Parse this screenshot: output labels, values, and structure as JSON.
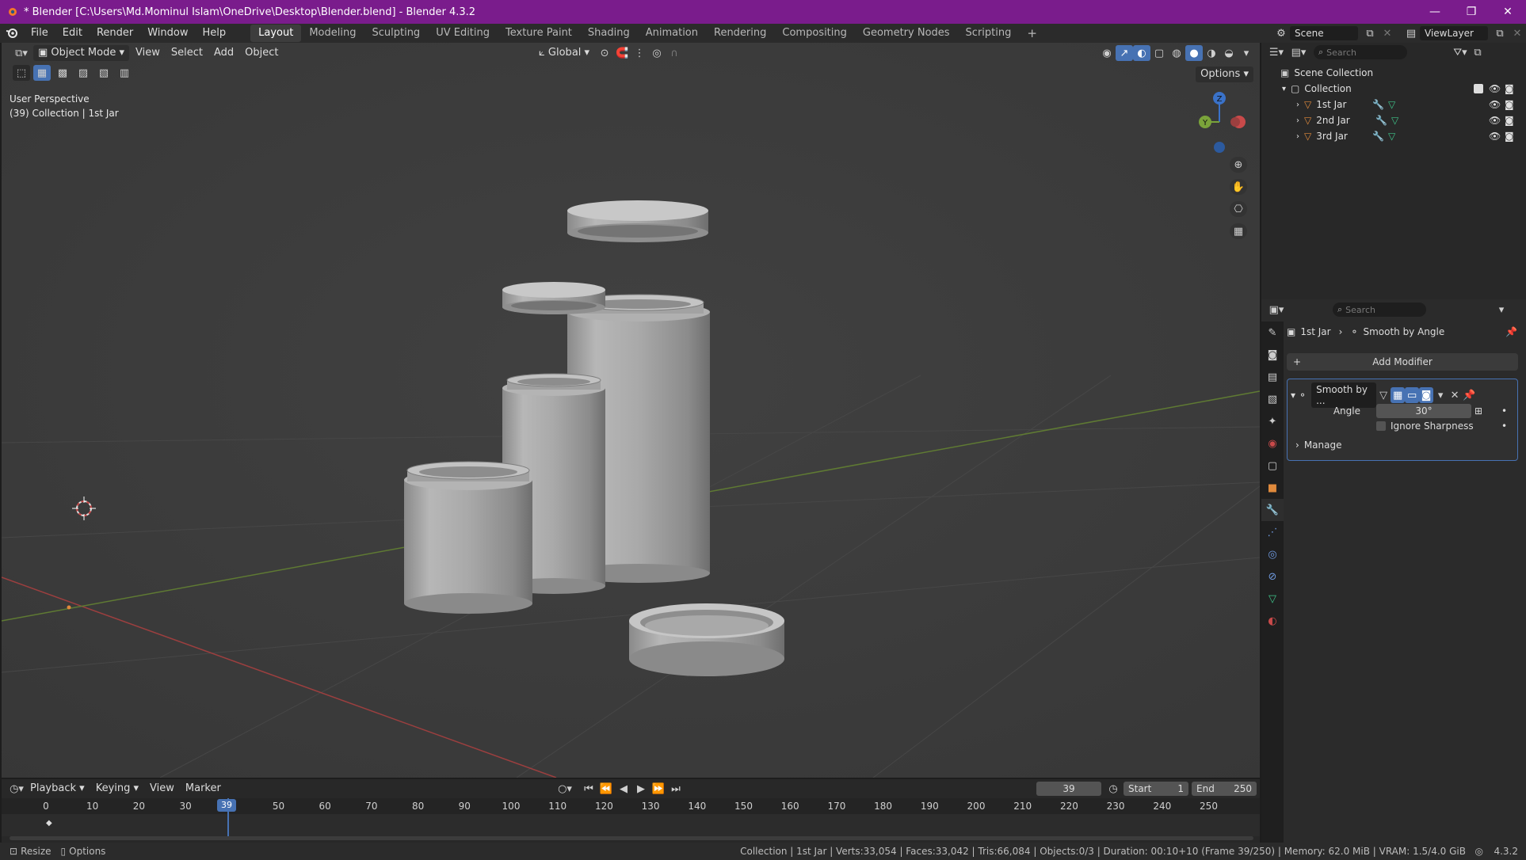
{
  "window": {
    "title": "* Blender [C:\\Users\\Md.Mominul Islam\\OneDrive\\Desktop\\Blender.blend] - Blender 4.3.2",
    "minimize": "—",
    "maximize": "❐",
    "close": "✕"
  },
  "menu": {
    "items": [
      "File",
      "Edit",
      "Render",
      "Window",
      "Help"
    ]
  },
  "workspaces": [
    "Layout",
    "Modeling",
    "Sculpting",
    "UV Editing",
    "Texture Paint",
    "Shading",
    "Animation",
    "Rendering",
    "Compositing",
    "Geometry Nodes",
    "Scripting"
  ],
  "workspace_add": "+",
  "scene": {
    "scene_name": "Scene",
    "view_layer": "ViewLayer"
  },
  "viewport": {
    "mode": "Object Mode",
    "menus": [
      "View",
      "Select",
      "Add",
      "Object"
    ],
    "orientation": "Global",
    "options": "Options",
    "info_line1": "User Perspective",
    "info_line2": "(39) Collection | 1st Jar",
    "gizmo": {
      "z": "Z",
      "y": "Y"
    }
  },
  "outliner": {
    "search_placeholder": "Search",
    "root": "Scene Collection",
    "collection": "Collection",
    "objects": [
      "1st Jar",
      "2nd Jar",
      "3rd Jar"
    ]
  },
  "properties": {
    "search_placeholder": "Search",
    "breadcrumb_object": "1st Jar",
    "breadcrumb_modifier": "Smooth by Angle",
    "add_modifier": "Add Modifier",
    "modifier_name": "Smooth by ...",
    "angle_label": "Angle",
    "angle_value": "30°",
    "ignore_sharpness": "Ignore Sharpness",
    "manage": "Manage"
  },
  "timeline": {
    "menus": [
      "Playback",
      "Keying",
      "View",
      "Marker"
    ],
    "current_frame": "39",
    "start_label": "Start",
    "start_value": "1",
    "end_label": "End",
    "end_value": "250",
    "ruler": [
      "0",
      "10",
      "20",
      "30",
      "50",
      "60",
      "70",
      "80",
      "90",
      "100",
      "110",
      "120",
      "130",
      "140",
      "150",
      "160",
      "170",
      "180",
      "190",
      "200",
      "210",
      "220",
      "230",
      "240",
      "250"
    ],
    "playhead_label": "39"
  },
  "status": {
    "left1": "Resize",
    "left2": "Options",
    "right": "Collection | 1st Jar | Verts:33,054 | Faces:33,042 | Tris:66,084 | Objects:0/3 | Duration: 00:10+10 (Frame 39/250) | Memory: 62.0 MiB | VRAM: 1.5/4.0 GiB",
    "version": "4.3.2"
  },
  "colors": {
    "titlebar": "#7a1c8c",
    "viewport_bg": "#3f3f3f",
    "accent_blue": "#4772b3",
    "axis_x": "#c94a4a",
    "axis_y": "#7aa33a",
    "axis_z": "#3a72c9",
    "object_orange": "#e08a3c"
  }
}
